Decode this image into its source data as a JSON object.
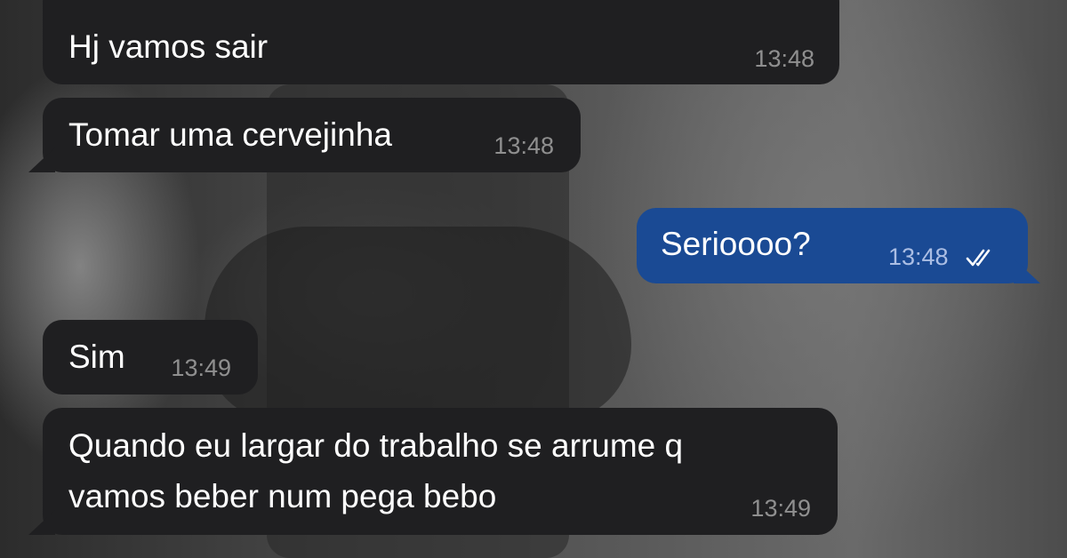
{
  "messages": [
    {
      "id": "m1",
      "direction": "incoming",
      "lines": [
        "Hj vamos sair"
      ],
      "time": "13:48"
    },
    {
      "id": "m2",
      "direction": "incoming",
      "lines": [
        "Tomar uma cervejinha"
      ],
      "time": "13:48"
    },
    {
      "id": "m3",
      "direction": "outgoing",
      "lines": [
        "Serioooo?"
      ],
      "time": "13:48",
      "status_icon": "double-check-icon"
    },
    {
      "id": "m4",
      "direction": "incoming",
      "lines": [
        "Sim"
      ],
      "time": "13:49"
    },
    {
      "id": "m5",
      "direction": "incoming",
      "lines": [
        "Quando eu largar do trabalho se arrume q",
        "vamos beber num pega bebo"
      ],
      "time": "13:49"
    }
  ],
  "colors": {
    "incoming_bubble": "#1f1f21",
    "outgoing_bubble": "#1a4a94",
    "text": "#ffffff"
  }
}
